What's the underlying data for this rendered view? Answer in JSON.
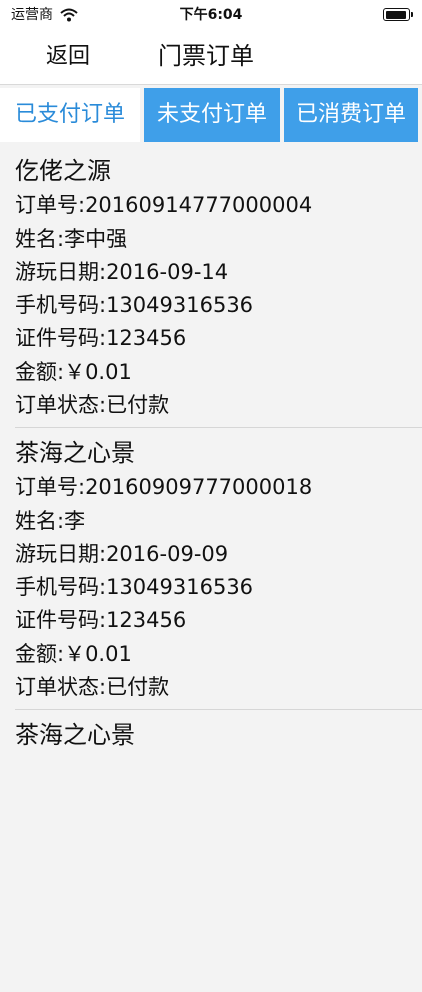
{
  "status_bar": {
    "carrier": "运营商",
    "time": "下午6:04",
    "battery_level": 0.95
  },
  "nav": {
    "back_label": "返回",
    "title": "门票订单"
  },
  "tabs": [
    {
      "label": "已支付订单",
      "active": true
    },
    {
      "label": "未支付订单",
      "active": false
    },
    {
      "label": "已消费订单",
      "active": false
    }
  ],
  "orders": [
    {
      "name": "仡佬之源",
      "order_no": "订单号:20160914777000004",
      "customer": "姓名:李中强",
      "visit_date": "游玩日期:2016-09-14",
      "phone": "手机号码:13049316536",
      "id_no": "证件号码:123456",
      "amount": "金额:￥0.01",
      "status": "订单状态:已付款"
    },
    {
      "name": "茶海之心景",
      "order_no": "订单号:20160909777000018",
      "customer": "姓名:李",
      "visit_date": "游玩日期:2016-09-09",
      "phone": "手机号码:13049316536",
      "id_no": "证件号码:123456",
      "amount": "金额:￥0.01",
      "status": "订单状态:已付款"
    },
    {
      "name": "茶海之心景"
    }
  ]
}
